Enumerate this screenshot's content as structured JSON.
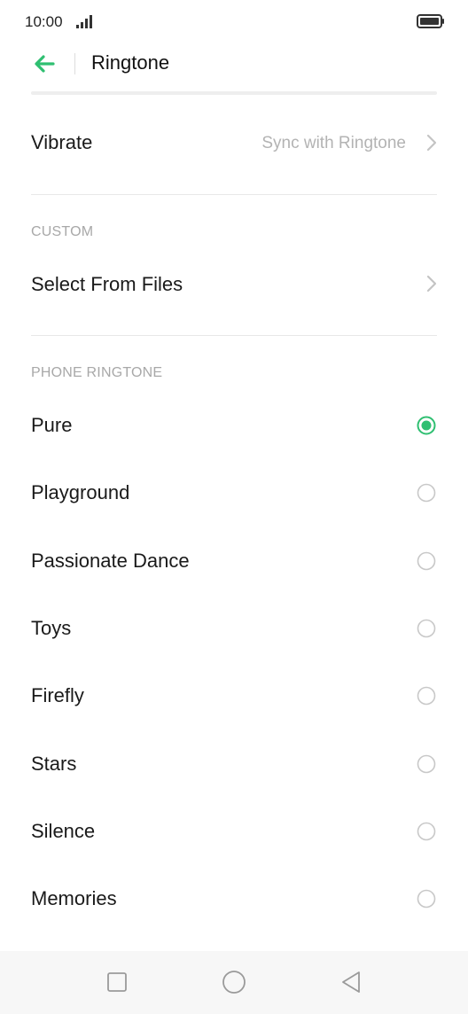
{
  "status_bar": {
    "time": "10:00"
  },
  "header": {
    "title": "Ringtone",
    "back_icon": "arrow-left-icon"
  },
  "vibrate": {
    "label": "Vibrate",
    "value": "Sync with Ringtone"
  },
  "custom_section": {
    "header": "CUSTOM",
    "select_files_label": "Select From Files"
  },
  "ringtone_section": {
    "header": "PHONE RINGTONE",
    "items": [
      {
        "label": "Pure",
        "selected": true
      },
      {
        "label": "Playground",
        "selected": false
      },
      {
        "label": "Passionate Dance",
        "selected": false
      },
      {
        "label": "Toys",
        "selected": false
      },
      {
        "label": "Firefly",
        "selected": false
      },
      {
        "label": "Stars",
        "selected": false
      },
      {
        "label": "Silence",
        "selected": false
      },
      {
        "label": "Memories",
        "selected": false
      }
    ]
  },
  "nav_bar": {
    "buttons": [
      "square-icon",
      "circle-icon",
      "triangle-back-icon"
    ]
  },
  "colors": {
    "accent": "#2fbf71",
    "secondary_text": "#b3b3b3",
    "section_header": "#a8a8a8",
    "divider": "#e8e8e8"
  }
}
